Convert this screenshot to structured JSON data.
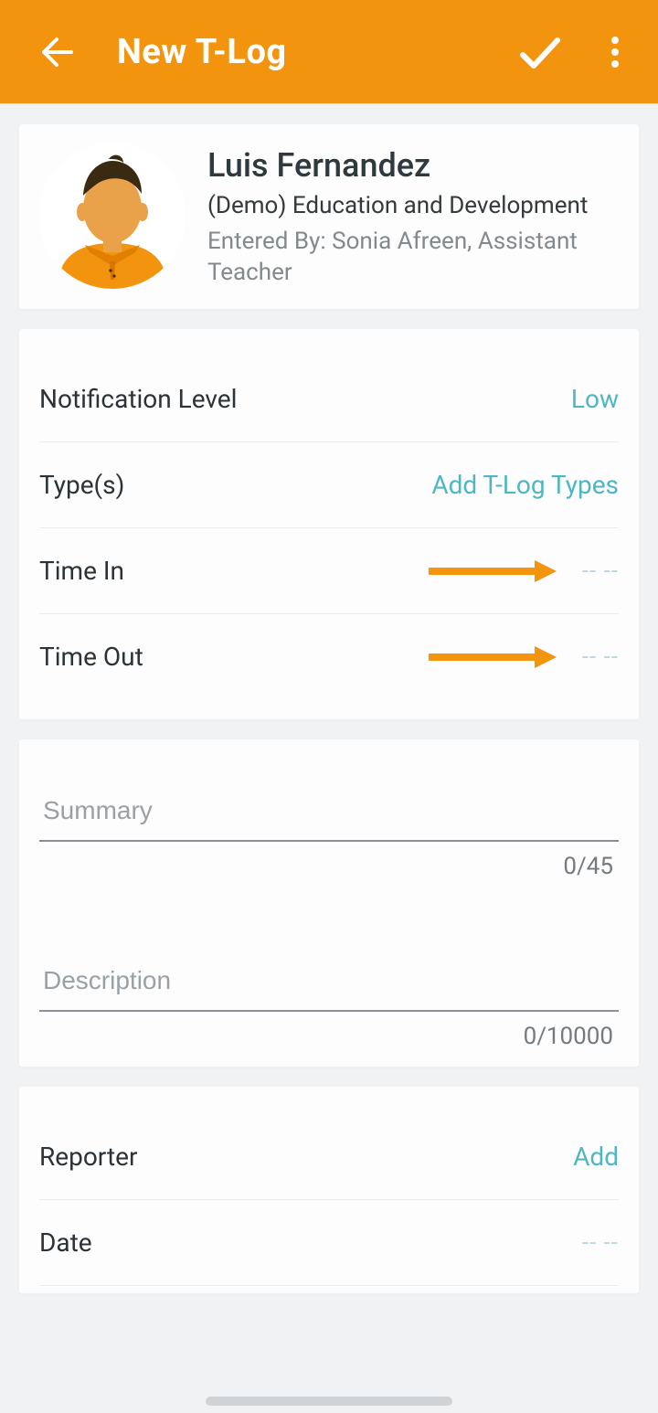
{
  "header": {
    "title": "New T-Log"
  },
  "person": {
    "name": "Luis Fernandez",
    "context": "(Demo) Education and Development",
    "entered_by": "Entered By: Sonia Afreen, Assistant Teacher"
  },
  "fields": {
    "notification_level": {
      "label": "Notification Level",
      "value": "Low"
    },
    "types": {
      "label": "Type(s)",
      "action": "Add T-Log Types"
    },
    "time_in": {
      "label": "Time In",
      "value": "-- --"
    },
    "time_out": {
      "label": "Time Out",
      "value": "-- --"
    }
  },
  "textfields": {
    "summary": {
      "placeholder": "Summary",
      "counter": "0/45"
    },
    "description": {
      "placeholder": "Description",
      "counter": "0/10000"
    }
  },
  "reporter": {
    "label": "Reporter",
    "action": "Add"
  },
  "date": {
    "label": "Date",
    "value": "-- --"
  }
}
